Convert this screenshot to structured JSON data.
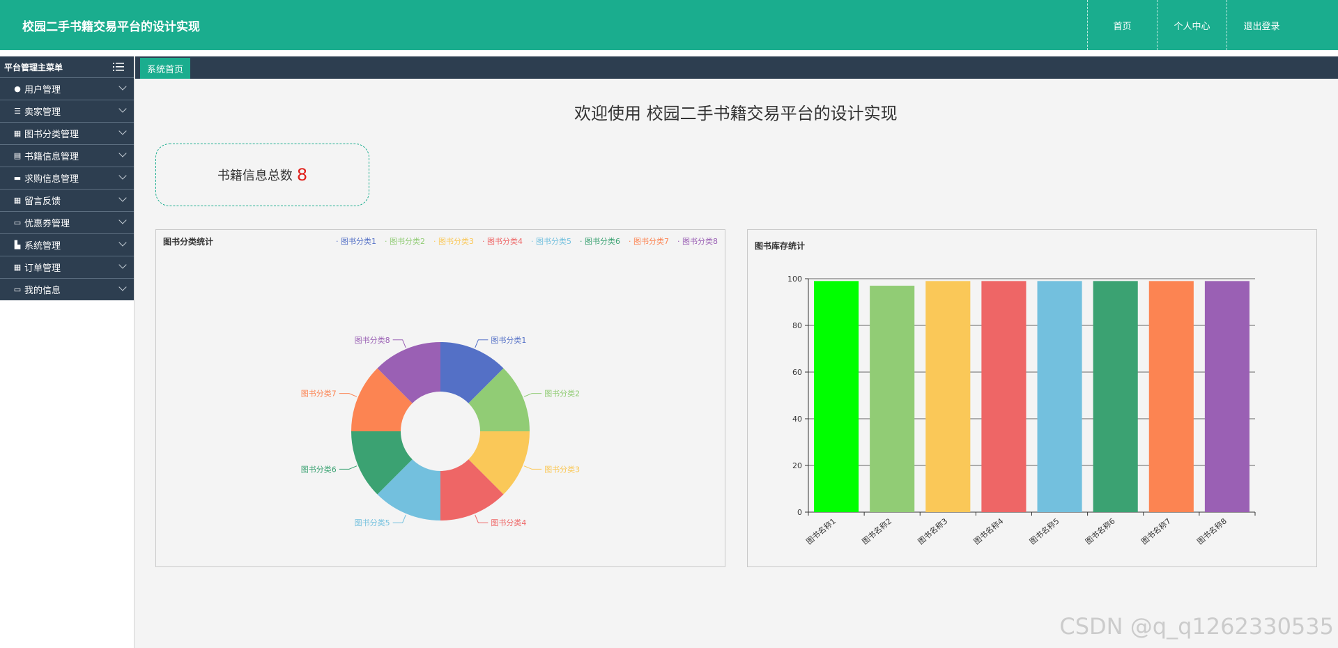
{
  "header": {
    "title": "校园二手书籍交易平台的设计实现",
    "nav": [
      "首页",
      "个人中心",
      "退出登录"
    ]
  },
  "sidebar": {
    "heading": "平台管理主菜单",
    "items": [
      {
        "label": "用户管理",
        "icon": "location-pin-icon"
      },
      {
        "label": "卖家管理",
        "icon": "sliders-icon"
      },
      {
        "label": "图书分类管理",
        "icon": "grid-icon"
      },
      {
        "label": "书籍信息管理",
        "icon": "printer-icon"
      },
      {
        "label": "求购信息管理",
        "icon": "message-icon"
      },
      {
        "label": "留言反馈",
        "icon": "grid-icon"
      },
      {
        "label": "优惠券管理",
        "icon": "monitor-icon"
      },
      {
        "label": "系统管理",
        "icon": "chart-icon"
      },
      {
        "label": "订单管理",
        "icon": "table-icon"
      },
      {
        "label": "我的信息",
        "icon": "card-icon"
      }
    ]
  },
  "tabs": {
    "active": "系统首页"
  },
  "main": {
    "welcome": "欢迎使用 校园二手书籍交易平台的设计实现",
    "stat": {
      "label": "书籍信息总数",
      "value": "8"
    }
  },
  "colors": {
    "brand": "#1aad8e",
    "sidebar": "#2d3e50",
    "palette": [
      "#5470c6",
      "#91cc75",
      "#fac858",
      "#ee6666",
      "#73c0de",
      "#3ba272",
      "#fc8452",
      "#9a60b4"
    ],
    "bar_first": "#00ff00"
  },
  "chart_data": [
    {
      "type": "pie",
      "variant": "donut",
      "title": "图书分类统计",
      "legend_position": "top-right",
      "categories": [
        "图书分类1",
        "图书分类2",
        "图书分类3",
        "图书分类4",
        "图书分类5",
        "图书分类6",
        "图书分类7",
        "图书分类8"
      ],
      "values": [
        1,
        1,
        1,
        1,
        1,
        1,
        1,
        1
      ]
    },
    {
      "type": "bar",
      "title": "图书库存统计",
      "categories": [
        "图书名称1",
        "图书名称2",
        "图书名称3",
        "图书名称4",
        "图书名称5",
        "图书名称6",
        "图书名称7",
        "图书名称8"
      ],
      "values": [
        99,
        97,
        99,
        99,
        99,
        99,
        99,
        99
      ],
      "ylim": [
        0,
        100
      ],
      "yticks": [
        0,
        20,
        40,
        60,
        80,
        100
      ],
      "grid": true
    }
  ],
  "watermark": "CSDN @q_q1262330535"
}
